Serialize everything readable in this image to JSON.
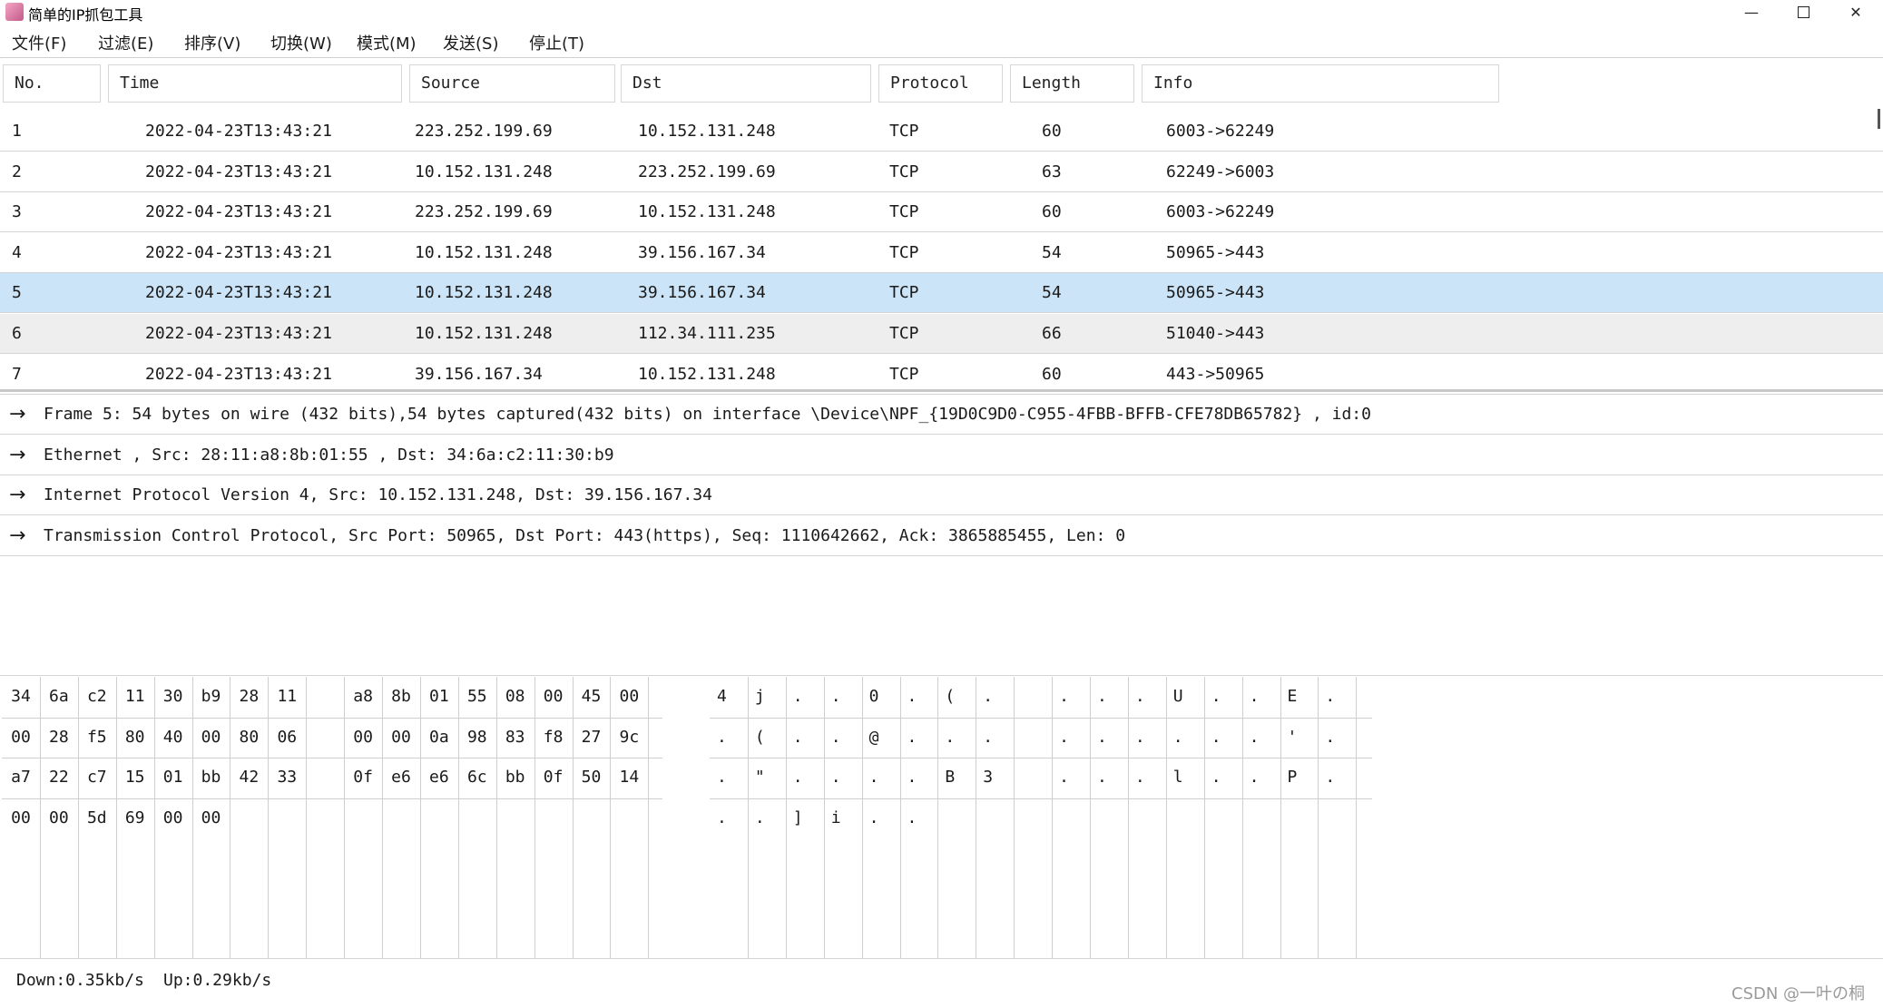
{
  "window": {
    "title": "简单的IP抓包工具",
    "minimize": "—",
    "close": "✕"
  },
  "menu": [
    "文件(F)",
    "过滤(E)",
    "排序(V)",
    "切换(W)",
    "模式(M)",
    "发送(S)",
    "停止(T)"
  ],
  "table": {
    "columns": [
      "No.",
      "Time",
      "Source",
      "Dst",
      "Protocol",
      "Length",
      "Info"
    ],
    "rows": [
      [
        "1",
        "2022-04-23T13:43:21",
        "223.252.199.69",
        "10.152.131.248",
        "TCP",
        "60",
        "6003->62249"
      ],
      [
        "2",
        "2022-04-23T13:43:21",
        "10.152.131.248",
        "223.252.199.69",
        "TCP",
        "63",
        "62249->6003"
      ],
      [
        "3",
        "2022-04-23T13:43:21",
        "223.252.199.69",
        "10.152.131.248",
        "TCP",
        "60",
        "6003->62249"
      ],
      [
        "4",
        "2022-04-23T13:43:21",
        "10.152.131.248",
        "39.156.167.34",
        "TCP",
        "54",
        "50965->443"
      ],
      [
        "5",
        "2022-04-23T13:43:21",
        "10.152.131.248",
        "39.156.167.34",
        "TCP",
        "54",
        "50965->443"
      ],
      [
        "6",
        "2022-04-23T13:43:21",
        "10.152.131.248",
        "112.34.111.235",
        "TCP",
        "66",
        "51040->443"
      ],
      [
        "7",
        "2022-04-23T13:43:21",
        "39.156.167.34",
        "10.152.131.248",
        "TCP",
        "60",
        "443->50965"
      ]
    ],
    "selected_row": 5
  },
  "details": {
    "arrow": "→",
    "lines": [
      "Frame 5: 54 bytes on wire (432 bits),54 bytes captured(432 bits) on interface \\Device\\NPF_{19D0C9D0-C955-4FBB-BFFB-CFE78DB65782} , id:0",
      "Ethernet , Src: 28:11:a8:8b:01:55 , Dst: 34:6a:c2:11:30:b9",
      "Internet Protocol Version 4, Src: 10.152.131.248, Dst: 39.156.167.34",
      "Transmission Control Protocol, Src Port: 50965, Dst Port: 443(https), Seq: 1110642662, Ack: 3865885455, Len: 0"
    ]
  },
  "hex": {
    "rows": [
      [
        "34",
        "6a",
        "c2",
        "11",
        "30",
        "b9",
        "28",
        "11",
        "",
        "a8",
        "8b",
        "01",
        "55",
        "08",
        "00",
        "45",
        "00"
      ],
      [
        "00",
        "28",
        "f5",
        "80",
        "40",
        "00",
        "80",
        "06",
        "",
        "00",
        "00",
        "0a",
        "98",
        "83",
        "f8",
        "27",
        "9c"
      ],
      [
        "a7",
        "22",
        "c7",
        "15",
        "01",
        "bb",
        "42",
        "33",
        "",
        "0f",
        "e6",
        "e6",
        "6c",
        "bb",
        "0f",
        "50",
        "14"
      ],
      [
        "00",
        "00",
        "5d",
        "69",
        "00",
        "00"
      ]
    ]
  },
  "ascii": {
    "rows": [
      [
        "4",
        "j",
        ".",
        ".",
        "0",
        ".",
        "(",
        ".",
        "",
        ".",
        ".",
        ".",
        "U",
        ".",
        ".",
        "E",
        "."
      ],
      [
        ".",
        "(",
        ".",
        ".",
        "@",
        ".",
        ".",
        ".",
        "",
        ".",
        ".",
        ".",
        ".",
        ".",
        ".",
        "'",
        "."
      ],
      [
        ".",
        "\"",
        ".",
        ".",
        ".",
        ".",
        "B",
        "3",
        "",
        ".",
        ".",
        ".",
        "l",
        ".",
        ".",
        "P",
        "."
      ],
      [
        ".",
        ".",
        "]",
        "i",
        ".",
        "."
      ]
    ]
  },
  "status": {
    "down": "Down:0.35kb/s",
    "up": "Up:0.29kb/s"
  },
  "watermark": "CSDN @一叶の桐"
}
